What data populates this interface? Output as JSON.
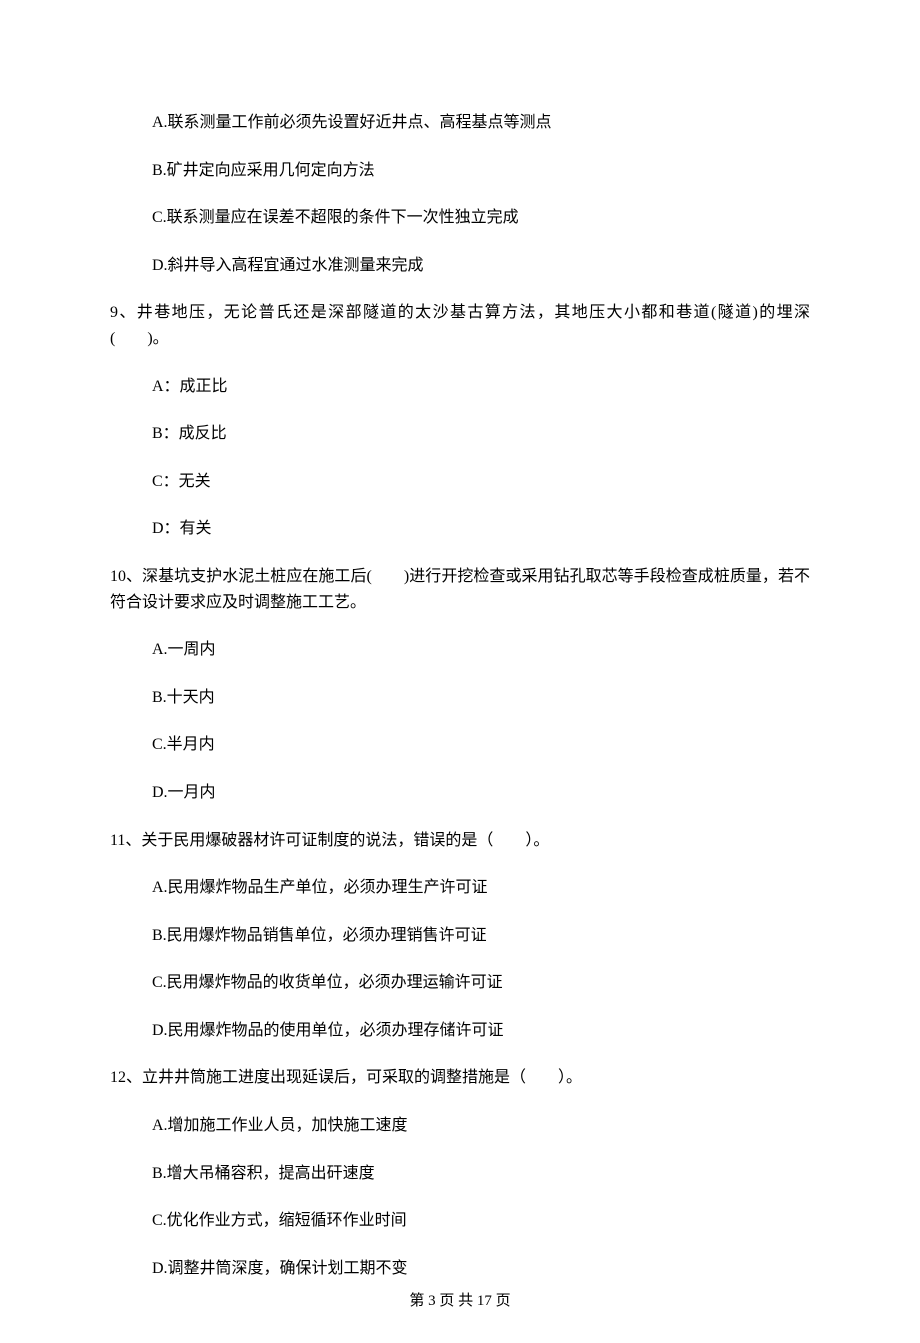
{
  "q8_options": {
    "a": "A.联系测量工作前必须先设置好近井点、高程基点等测点",
    "b": "B.矿井定向应采用几何定向方法",
    "c": "C.联系测量应在误差不超限的条件下一次性独立完成",
    "d": "D.斜井导入高程宜通过水准测量来完成"
  },
  "q9": {
    "text": "9、井巷地压，无论普氏还是深部隧道的太沙基古算方法，其地压大小都和巷道(隧道)的埋深(　　)。",
    "a": "A：成正比",
    "b": "B：成反比",
    "c": "C：无关",
    "d": "D：有关"
  },
  "q10": {
    "text": "10、深基坑支护水泥土桩应在施工后(　　)进行开挖检查或采用钻孔取芯等手段检查成桩质量，若不符合设计要求应及时调整施工工艺。",
    "a": "A.一周内",
    "b": "B.十天内",
    "c": "C.半月内",
    "d": "D.一月内"
  },
  "q11": {
    "text": "11、关于民用爆破器材许可证制度的说法，错误的是（　　）。",
    "a": "A.民用爆炸物品生产单位，必须办理生产许可证",
    "b": "B.民用爆炸物品销售单位，必须办理销售许可证",
    "c": "C.民用爆炸物品的收货单位，必须办理运输许可证",
    "d": "D.民用爆炸物品的使用单位，必须办理存储许可证"
  },
  "q12": {
    "text": "12、立井井筒施工进度出现延误后，可采取的调整措施是（　　）。",
    "a": "A.增加施工作业人员，加快施工速度",
    "b": "B.增大吊桶容积，提高出矸速度",
    "c": "C.优化作业方式，缩短循环作业时间",
    "d": "D.调整井筒深度，确保计划工期不变"
  },
  "footer": "第 3 页 共 17 页"
}
